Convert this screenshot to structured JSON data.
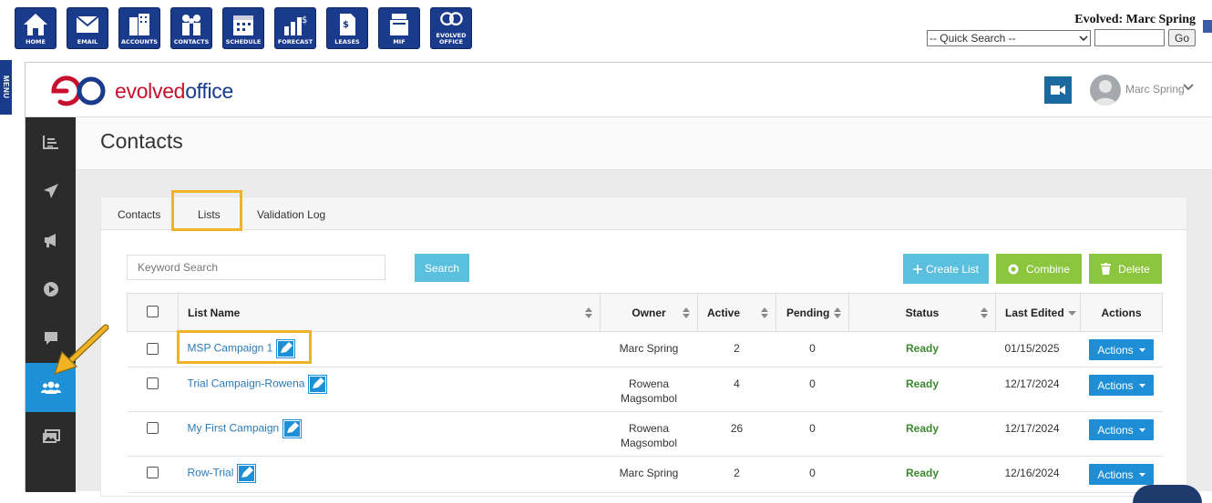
{
  "toolbar": {
    "items": [
      {
        "label": "HOME",
        "icon": "home-icon"
      },
      {
        "label": "EMAIL",
        "icon": "email-icon"
      },
      {
        "label": "ACCOUNTS",
        "icon": "accounts-icon"
      },
      {
        "label": "CONTACTS",
        "icon": "contacts-icon"
      },
      {
        "label": "SCHEDULE",
        "icon": "calendar-icon"
      },
      {
        "label": "FORECAST",
        "icon": "forecast-icon"
      },
      {
        "label": "LEASES",
        "icon": "leases-icon"
      },
      {
        "label": "MIF",
        "icon": "copier-icon"
      },
      {
        "label": "EVOLVED\nOFFICE",
        "icon": "evolved-logo-icon"
      }
    ],
    "user_banner": "Evolved: Marc Spring",
    "quick_search_selected": "-- Quick Search --",
    "go_label": "Go"
  },
  "menu_tab_label": "MENU",
  "brand": {
    "prefix": "evolved",
    "suffix": "office",
    "accent_red": "#c8102e",
    "accent_blue": "#1a3a8c"
  },
  "header": {
    "user_name": "Marc Spring"
  },
  "page_title": "Contacts",
  "tabs": [
    {
      "label": "Contacts",
      "active": false
    },
    {
      "label": "Lists",
      "active": true
    },
    {
      "label": "Validation Log",
      "active": false
    }
  ],
  "search": {
    "placeholder": "Keyword Search",
    "button_label": "Search"
  },
  "actions": {
    "create_label": "Create List",
    "combine_label": "Combine",
    "delete_label": "Delete"
  },
  "table": {
    "columns": [
      "List Name",
      "Owner",
      "Active",
      "Pending",
      "Status",
      "Last Edited",
      "Actions"
    ],
    "rows": [
      {
        "name": "MSP Campaign 1",
        "owner": "Marc Spring",
        "active": "2",
        "pending": "0",
        "status": "Ready",
        "edited": "01/15/2025",
        "action": "Actions"
      },
      {
        "name": "Trial Campaign-Rowena",
        "owner": "Rowena Magsombol",
        "active": "4",
        "pending": "0",
        "status": "Ready",
        "edited": "12/17/2024",
        "action": "Actions"
      },
      {
        "name": "My First Campaign",
        "owner": "Rowena Magsombol",
        "active": "26",
        "pending": "0",
        "status": "Ready",
        "edited": "12/17/2024",
        "action": "Actions"
      },
      {
        "name": "Row-Trial",
        "owner": "Marc Spring",
        "active": "2",
        "pending": "0",
        "status": "Ready",
        "edited": "12/16/2024",
        "action": "Actions"
      }
    ]
  },
  "colors": {
    "primary_blue": "#1e8fd6",
    "info": "#5bc0de",
    "success": "#8cc63f",
    "sidebar": "#2b2b2b",
    "highlight": "#f0b323"
  }
}
